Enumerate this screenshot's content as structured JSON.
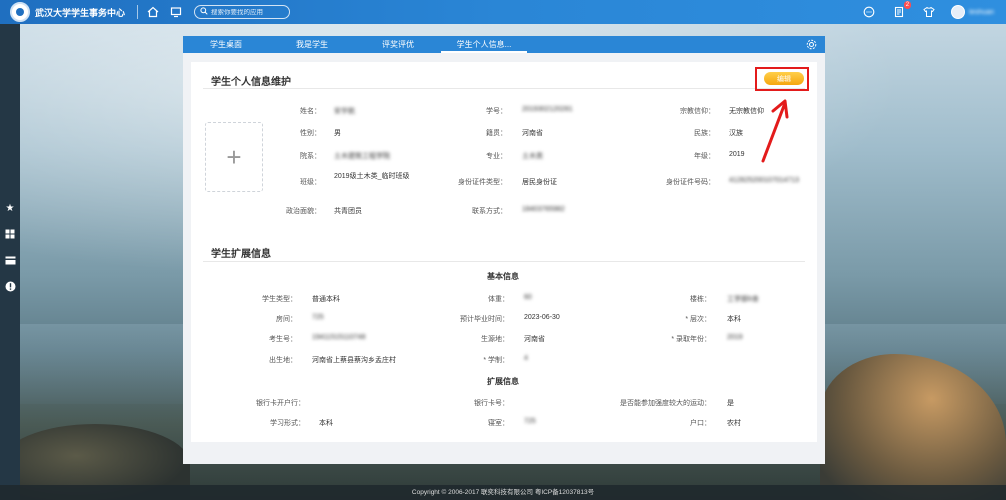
{
  "app": {
    "title": "武汉大学学生事务中心",
    "search_placeholder": "搜索你要找的应用",
    "notification_count": "2",
    "username": "teshuan",
    "colors": {
      "topbar": "#2a86d6",
      "edit_button": "#f5a60f",
      "highlight": "#e31b1b"
    }
  },
  "topbar_icons": [
    "home-icon",
    "monitor-icon",
    "chat-icon",
    "notification-icon",
    "shirt-icon"
  ],
  "tabs": [
    {
      "label": "学生桌面",
      "active": false
    },
    {
      "label": "我是学生",
      "active": false
    },
    {
      "label": "评奖评优",
      "active": false
    },
    {
      "label": "学生个人信息...",
      "active": true
    }
  ],
  "basic": {
    "title": "学生个人信息维护",
    "edit_label": "编辑",
    "photo_glyph": "+",
    "fields": {
      "name": {
        "label": "姓名：",
        "value": "安宇航"
      },
      "gender": {
        "label": "性别：",
        "value": "男"
      },
      "dept": {
        "label": "院系：",
        "value": "土木建筑工程学院"
      },
      "class": {
        "label": "班级：",
        "value": "2019级土木类_临时班级"
      },
      "political": {
        "label": "政治面貌：",
        "value": "共青团员"
      },
      "student_id": {
        "label": "学号：",
        "value": "2019302120281"
      },
      "native": {
        "label": "籍贯：",
        "value": "河南省"
      },
      "major": {
        "label": "专业：",
        "value": "土木类"
      },
      "id_type": {
        "label": "身份证件类型：",
        "value": "居民身份证"
      },
      "phone": {
        "label": "联系方式：",
        "value": "18403765982"
      },
      "religion": {
        "label": "宗教信仰：",
        "value": "无宗教信仰"
      },
      "ethnic": {
        "label": "民族：",
        "value": "汉族"
      },
      "grade": {
        "label": "年级：",
        "value": "2019"
      },
      "id_no": {
        "label": "身份证件号码：",
        "value": "412825200107014713"
      }
    }
  },
  "extended": {
    "title": "学生扩展信息",
    "subsection1": "基本信息",
    "subsection2": "扩展信息",
    "fields": {
      "student_type": {
        "label": "学生类型：",
        "value": "普通本科"
      },
      "dorm": {
        "label": "房间：",
        "value": "725"
      },
      "exam_no": {
        "label": "考生号：",
        "value": "19411515110748"
      },
      "birthplace": {
        "label": "出生地：",
        "value": "河南省上蔡县蔡沟乡孟庄村"
      },
      "weight": {
        "label": "体重：",
        "value": "60"
      },
      "grad_time": {
        "label": "预计毕业时间：",
        "value": "2023-06-30"
      },
      "origin": {
        "label": "生源地：",
        "value": "河南省"
      },
      "years": {
        "label": "* 学制：",
        "value": "4"
      },
      "building": {
        "label": "楼栋：",
        "value": "工学部6舍"
      },
      "level": {
        "label": "* 层次：",
        "value": "本科"
      },
      "enroll_year": {
        "label": "* 录取年份：",
        "value": "2019"
      },
      "bank_branch": {
        "label": "银行卡开户行：",
        "value": ""
      },
      "study_form": {
        "label": "学习形式：",
        "value": "本科"
      },
      "bank_card": {
        "label": "银行卡号：",
        "value": ""
      },
      "dorm2": {
        "label": "寝室：",
        "value": "725"
      },
      "sports": {
        "label": "是否能参加强度较大的运动：",
        "value": "是"
      },
      "hukou": {
        "label": "户口：",
        "value": "农村"
      }
    }
  },
  "footer": "Copyright © 2006-2017 联奕科技有限公司 粤ICP备12037813号"
}
